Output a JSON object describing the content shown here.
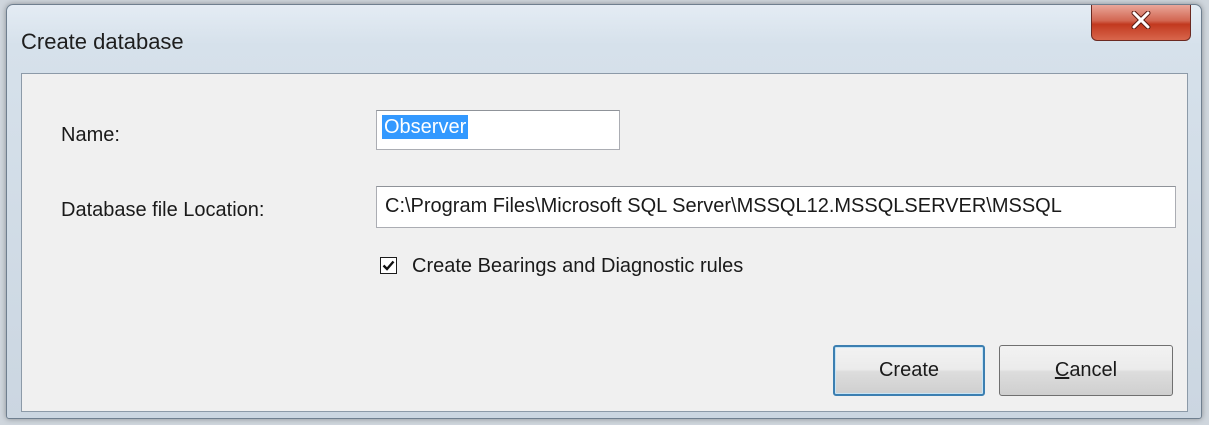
{
  "window": {
    "title": "Create database",
    "close_icon": "close-icon",
    "close_color": "#c8432a"
  },
  "form": {
    "name_label": "Name:",
    "name_value": "Observer",
    "location_label": "Database file Location:",
    "location_value": "C:\\Program Files\\Microsoft SQL Server\\MSSQL12.MSSQLSERVER\\MSSQL",
    "checkbox_label": "Create Bearings and Diagnostic rules",
    "checkbox_checked": true,
    "selection_color": "#3399ff"
  },
  "buttons": {
    "create_label": "Create",
    "cancel_label": "Cancel",
    "cancel_mnemonic": "C",
    "cancel_rest": "ancel"
  }
}
